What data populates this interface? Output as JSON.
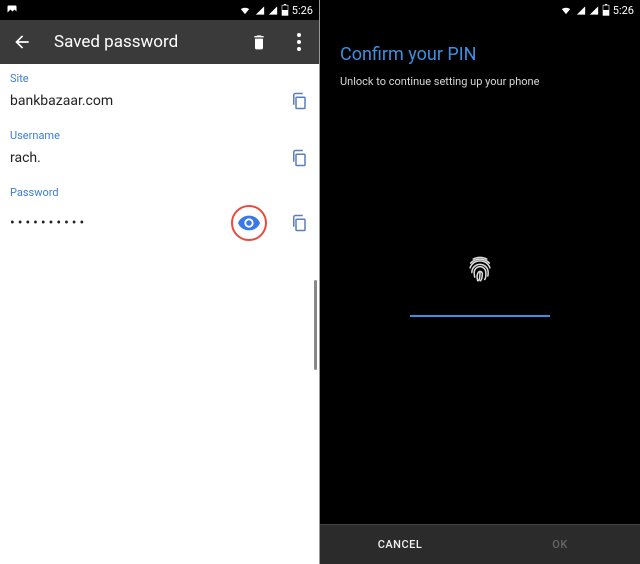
{
  "status": {
    "time": "5:26"
  },
  "left": {
    "header": {
      "title": "Saved password"
    },
    "fields": {
      "site": {
        "label": "Site",
        "value": "bankbazaar.com"
      },
      "username": {
        "label": "Username",
        "value": "rach."
      },
      "password": {
        "label": "Password",
        "value": "••••••••••"
      }
    }
  },
  "right": {
    "title": "Confirm your PIN",
    "subtitle": "Unlock to continue setting up your phone",
    "buttons": {
      "cancel": "CANCEL",
      "ok": "OK"
    }
  }
}
